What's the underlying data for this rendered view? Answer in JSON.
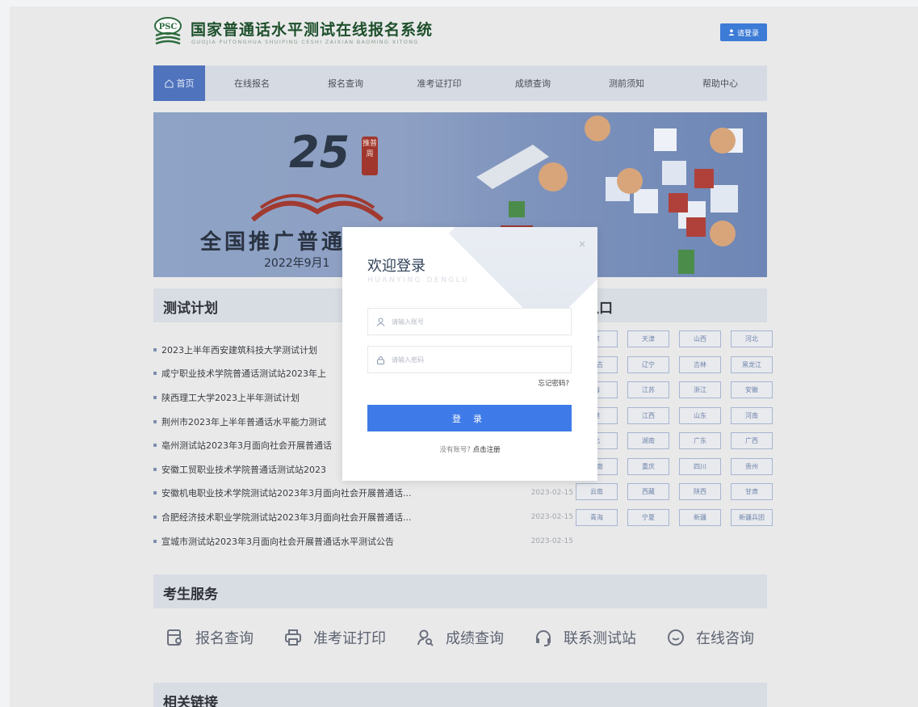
{
  "header": {
    "logo_text": "PSC",
    "title": "国家普通话水平测试在线报名系统",
    "subtitle": "GUOJIA PUTONGHUA SHUIPING CESHI ZAIXIAN BAOMING XITONG",
    "login_label": "请登录"
  },
  "nav": {
    "items": [
      "首页",
      "在线报名",
      "报名查询",
      "准考证打印",
      "成绩查询",
      "测前须知",
      "帮助中心"
    ]
  },
  "banner": {
    "number": "25",
    "seal": "推普周",
    "headline": "全国推广普通",
    "date": "2022年9月1"
  },
  "plan": {
    "title": "测试计划",
    "items": [
      {
        "text": "2023上半年西安建筑科技大学测试计划",
        "date": ""
      },
      {
        "text": "咸宁职业技术学院普通话测试站2023年上",
        "date": ""
      },
      {
        "text": "陕西理工大学2023上半年测试计划",
        "date": ""
      },
      {
        "text": "荆州市2023年上半年普通话水平能力测试",
        "date": ""
      },
      {
        "text": "亳州测试站2023年3月面向社会开展普通话",
        "date": ""
      },
      {
        "text": "安徽工贸职业技术学院普通话测试站2023",
        "date": ""
      },
      {
        "text": "安徽机电职业技术学院测试站2023年3月面向社会开展普通话...",
        "date": "2023-02-15"
      },
      {
        "text": "合肥经济技术职业学院测试站2023年3月面向社会开展普通话...",
        "date": "2023-02-15"
      },
      {
        "text": "宣城市测试站2023年3月面向社会开展普通话水平测试公告",
        "date": "2023-02-15"
      }
    ]
  },
  "registration": {
    "title": "名入口",
    "provinces": [
      "京",
      "天津",
      "山西",
      "河北",
      "蒙古",
      "辽宁",
      "吉林",
      "黑龙江",
      "海",
      "江苏",
      "浙江",
      "安徽",
      "建",
      "江西",
      "山东",
      "河南",
      "北",
      "湖南",
      "广东",
      "广西",
      "海南",
      "重庆",
      "四川",
      "贵州",
      "云南",
      "西藏",
      "陕西",
      "甘肃",
      "青海",
      "宁夏",
      "新疆",
      "新疆兵团"
    ]
  },
  "services": {
    "title": "考生服务",
    "items": [
      {
        "label": "报名查询",
        "icon": "search-doc-icon"
      },
      {
        "label": "准考证打印",
        "icon": "printer-icon"
      },
      {
        "label": "成绩查询",
        "icon": "user-search-icon"
      },
      {
        "label": "联系测试站",
        "icon": "headset-icon"
      },
      {
        "label": "在线咨询",
        "icon": "chat-icon"
      }
    ]
  },
  "links": {
    "title": "相关链接"
  },
  "modal": {
    "title": "欢迎登录",
    "subtitle": "HUANYING DENGLU",
    "close": "×",
    "username_placeholder": "请输入账号",
    "password_placeholder": "请输入密码",
    "forgot": "忘记密码?",
    "submit": "登 录",
    "register_prompt": "没有账号?",
    "register_link": "点击注册"
  },
  "colors": {
    "primary": "#3f7be8",
    "nav_active": "#4f73bd",
    "brand_green": "#1d4f2b"
  }
}
